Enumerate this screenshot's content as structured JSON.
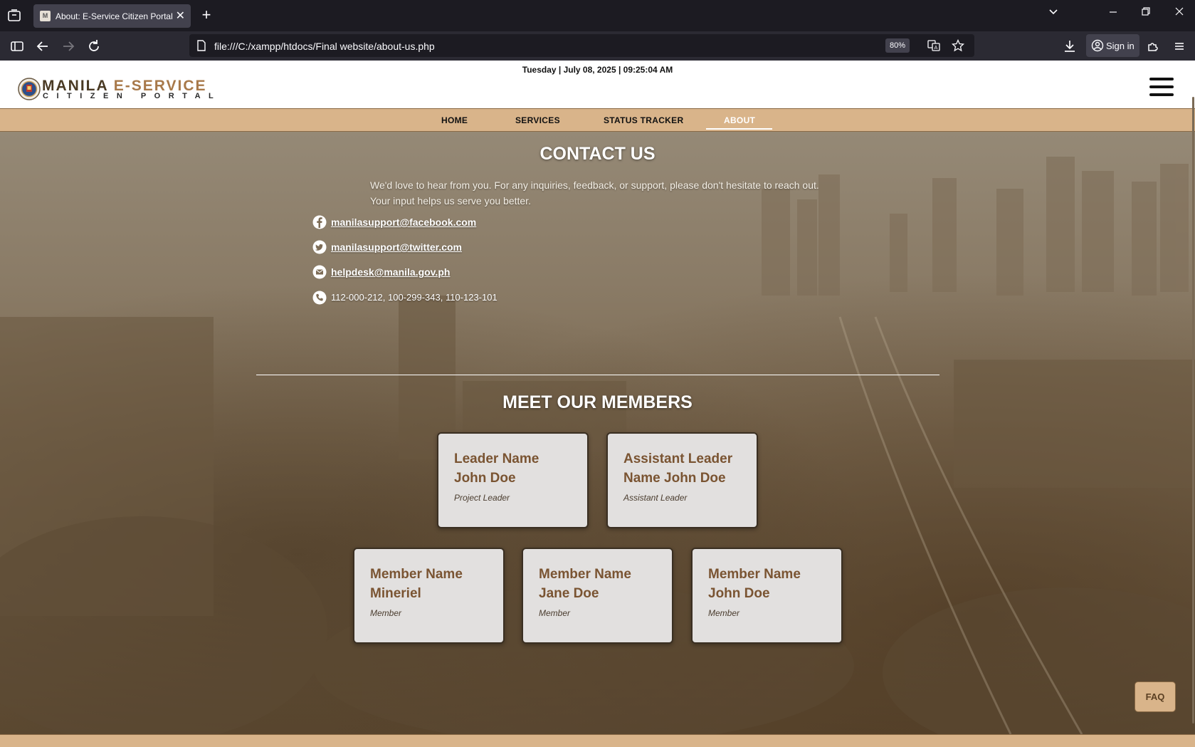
{
  "browser": {
    "tab_title": "About: E-Service Citizen Portal",
    "url": "file:///C:/xampp/htdocs/Final website/about-us.php",
    "zoom": "80%",
    "sign_in": "Sign in"
  },
  "header": {
    "datetime": "Tuesday | July 08, 2025 | 09:25:04 AM",
    "logo_line1_a": "MANILA ",
    "logo_line1_b": "E-SERVICE",
    "logo_line2": "CITIZEN PORTAL"
  },
  "nav": {
    "items": [
      {
        "label": "HOME"
      },
      {
        "label": "SERVICES"
      },
      {
        "label": "STATUS TRACKER"
      },
      {
        "label": "ABOUT"
      }
    ],
    "active": "ABOUT"
  },
  "contact": {
    "title": "CONTACT US",
    "text": "We'd love to hear from you. For any inquiries, feedback, or support, please don't hesitate to reach out. Your input helps us serve you better.",
    "facebook": "manilasupport@facebook.com",
    "twitter": "manilasupport@twitter.com",
    "email": "helpdesk@manila.gov.ph",
    "phones": "112-000-212,  100-299-343,  110-123-101"
  },
  "members": {
    "title": "MEET OUR MEMBERS",
    "cards": [
      {
        "name": "Leader Name John Doe",
        "role": "Project Leader"
      },
      {
        "name": "Assistant Leader Name John Doe",
        "role": "Assistant Leader"
      },
      {
        "name": "Member Name Mineriel",
        "role": "Member"
      },
      {
        "name": "Member Name Jane Doe",
        "role": "Member"
      },
      {
        "name": "Member Name John Doe",
        "role": "Member"
      }
    ]
  },
  "faq": "FAQ",
  "colors": {
    "nav_bg": "#d9b48a",
    "card_bg": "#e2e0df",
    "card_name": "#7a5432",
    "hero_tint": "#8a7b66"
  }
}
